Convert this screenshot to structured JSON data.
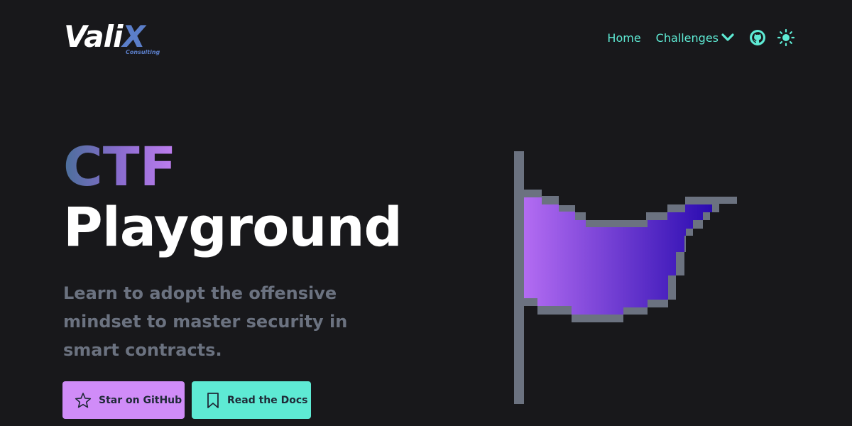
{
  "brand": {
    "logo_main": "Vali",
    "logo_x": "X",
    "logo_sub": "Consulting"
  },
  "nav": {
    "home": "Home",
    "challenges": "Challenges",
    "icons": [
      "github-icon",
      "sun-icon"
    ]
  },
  "hero": {
    "title_gradient": "CTF",
    "title": "Playground",
    "subtitle": "Learn to adopt the offensive mindset to master security in smart contracts."
  },
  "buttons": {
    "star": "Star on GitHub",
    "docs": "Read the Docs"
  },
  "colors": {
    "background": "#18181b",
    "accent_teal": "#5eead4",
    "accent_purple": "#d08cf8",
    "subtitle_gray": "#6b7280",
    "flag_gradient_start": "#b36cf2",
    "flag_gradient_end": "#2a0bb0",
    "flag_outline": "#6b7280"
  }
}
